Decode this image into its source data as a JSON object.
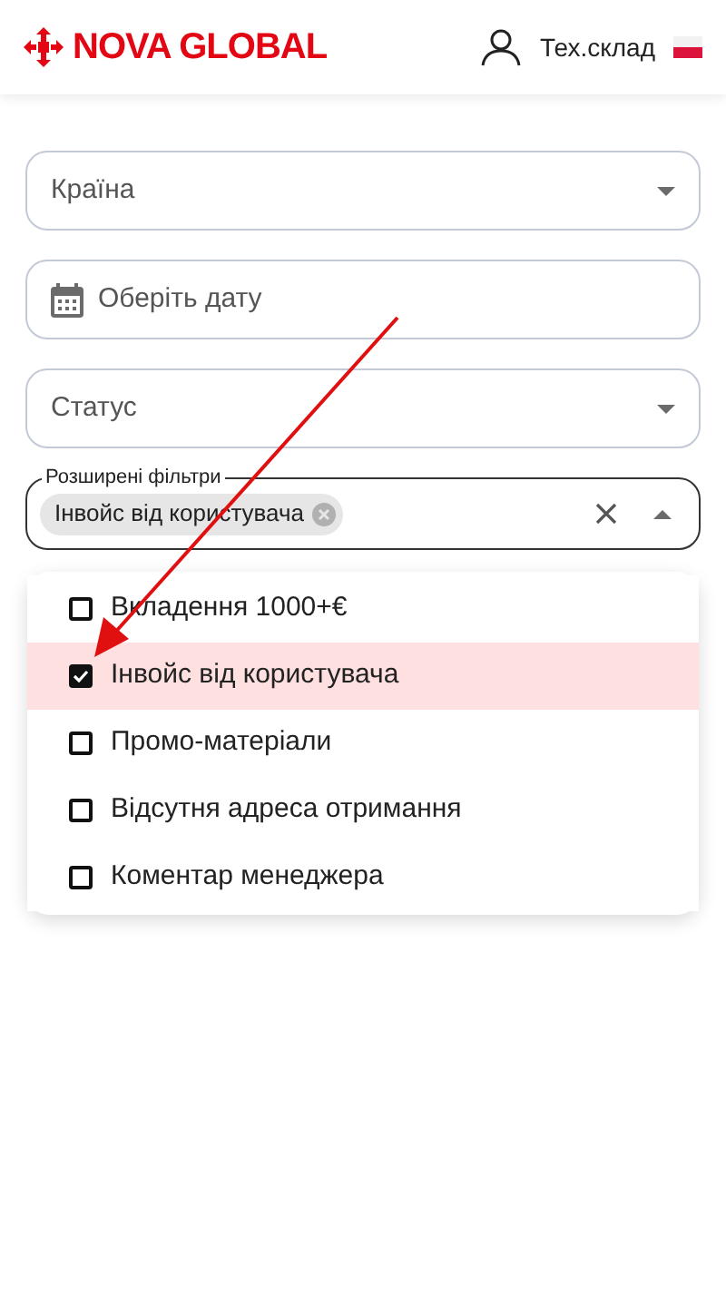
{
  "header": {
    "logo": "NOVA GLOBAL",
    "user": "Тех.склад"
  },
  "fields": [
    {
      "kind": "select",
      "placeholder": "Країна"
    },
    {
      "kind": "date",
      "placeholder": "Оберіть дату"
    },
    {
      "kind": "select",
      "placeholder": "Статус"
    }
  ],
  "extended_filters": {
    "label": "Розширені фільтри",
    "expanded": true,
    "chips": [
      "Інвойс від користувача"
    ]
  },
  "options": [
    {
      "label": "Вкладення 1000+€",
      "checked": false,
      "selected": false
    },
    {
      "label": "Інвойс від користувача",
      "checked": true,
      "selected": true
    },
    {
      "label": "Промо-матеріали",
      "checked": false,
      "selected": false
    },
    {
      "label": "Відсутня адреса отримання",
      "checked": false,
      "selected": false
    },
    {
      "label": "Коментар менеджера",
      "checked": false,
      "selected": false
    }
  ]
}
